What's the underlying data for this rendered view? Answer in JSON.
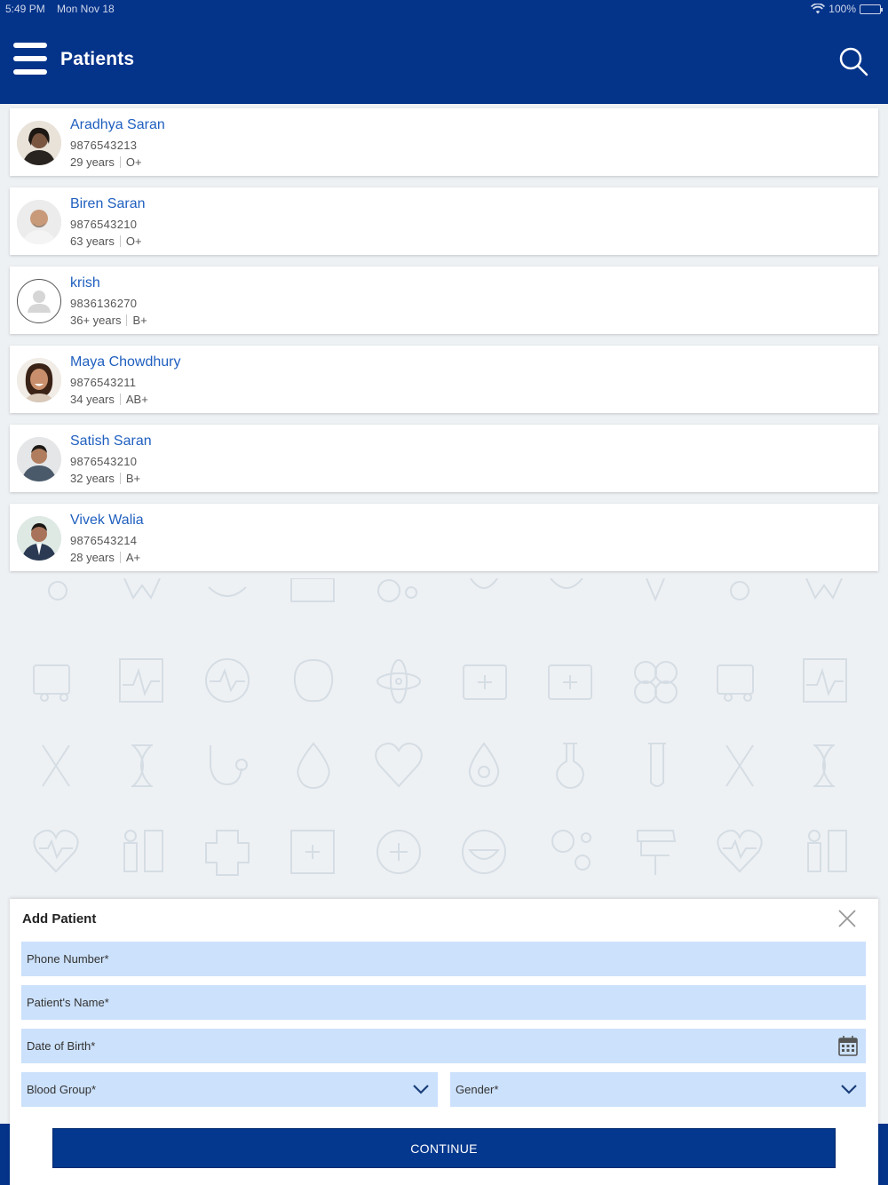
{
  "status_bar": {
    "time": "5:49 PM",
    "date": "Mon Nov 18",
    "battery": "100%"
  },
  "header": {
    "title": "Patients"
  },
  "patients": [
    {
      "name": "Aradhya Saran",
      "phone": "9876543213",
      "age": "29 years",
      "blood": "O+",
      "avatar": "female-photo"
    },
    {
      "name": "Biren Saran",
      "phone": "9876543210",
      "age": "63 years",
      "blood": "O+",
      "avatar": "male-elder-photo"
    },
    {
      "name": "krish",
      "phone": "9836136270",
      "age": "36+ years",
      "blood": "B+",
      "avatar": "placeholder-user"
    },
    {
      "name": "Maya Chowdhury",
      "phone": "9876543211",
      "age": "34 years",
      "blood": "AB+",
      "avatar": "female-photo"
    },
    {
      "name": "Satish Saran",
      "phone": "9876543210",
      "age": "32 years",
      "blood": "B+",
      "avatar": "male-photo"
    },
    {
      "name": "Vivek Walia",
      "phone": "9876543214",
      "age": "28 years",
      "blood": "A+",
      "avatar": "male-suit-photo"
    }
  ],
  "add_patient": {
    "title": "Add Patient",
    "phone_label": "Phone Number*",
    "name_label": "Patient's Name*",
    "dob_label": "Date of Birth*",
    "blood_label": "Blood Group*",
    "gender_label": "Gender*",
    "continue_label": "CONTINUE"
  },
  "colors": {
    "primary": "#04338a",
    "link": "#1f5fbf",
    "field_bg": "#cce1fb"
  }
}
